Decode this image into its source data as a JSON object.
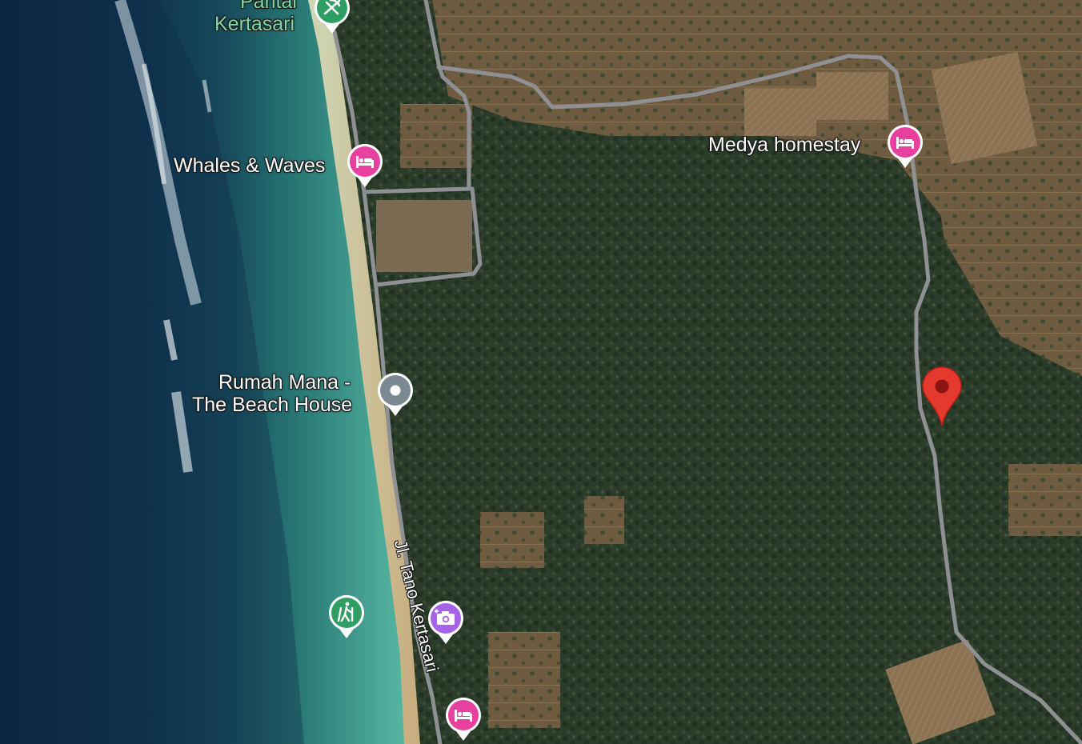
{
  "map": {
    "view": "satellite",
    "colors": {
      "road": "#8e9094",
      "lodging_pin": "#e8409f",
      "attraction_pin": "#a663e8",
      "park_pin": "#2f9e63",
      "generic_pin": "#7b8a92",
      "selected_marker": "#e43a2d"
    }
  },
  "places": {
    "pantai_kertasari": {
      "name_line1": "Pantai",
      "name_line2": "Kertasari",
      "icon": "beach-umbrella-icon"
    },
    "whales_waves": {
      "name": "Whales & Waves",
      "icon": "bed-icon"
    },
    "medya_homestay": {
      "name": "Medya homestay",
      "icon": "bed-icon"
    },
    "rumah_mana": {
      "name_line1": "Rumah Mana -",
      "name_line2": "The Beach House",
      "icon": "dot-icon"
    },
    "hiking": {
      "icon": "hiking-icon"
    },
    "photo_spot": {
      "icon": "camera-icon"
    },
    "lodging_bottom": {
      "icon": "bed-icon"
    }
  },
  "streets": {
    "main_road": "Jl. Tano Kertasari"
  },
  "selected": {
    "icon": "map-marker-icon"
  }
}
